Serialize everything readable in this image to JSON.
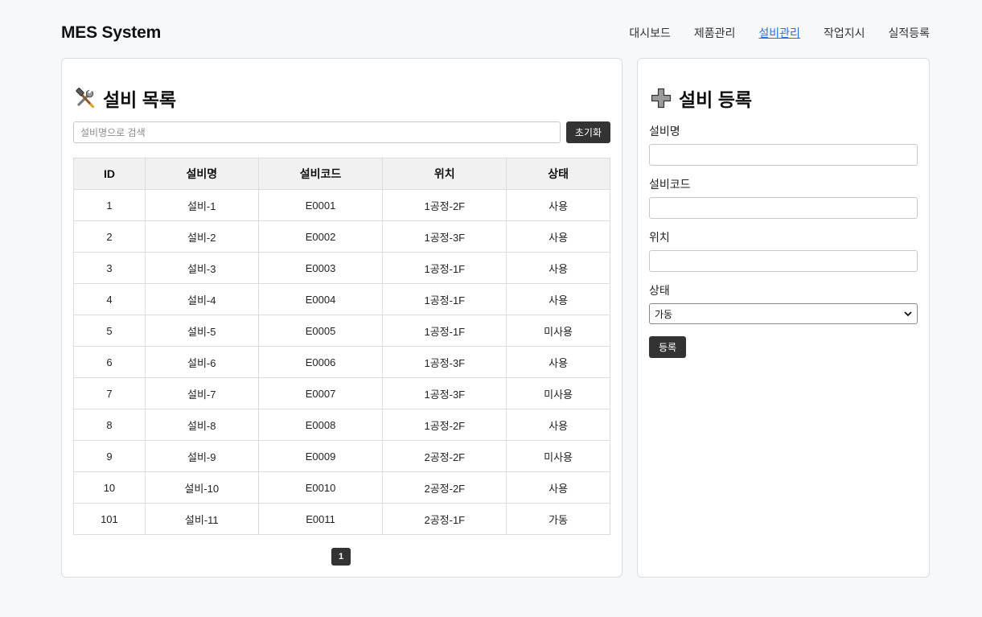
{
  "header": {
    "brand": "MES System",
    "nav": [
      {
        "label": "대시보드",
        "active": false
      },
      {
        "label": "제품관리",
        "active": false
      },
      {
        "label": "설비관리",
        "active": true
      },
      {
        "label": "작업지시",
        "active": false
      },
      {
        "label": "실적등록",
        "active": false
      }
    ]
  },
  "list": {
    "title": "설비 목록",
    "title_icon": "hammer-wrench-icon",
    "search_placeholder": "설비명으로 검색",
    "reset_label": "초기화",
    "columns": [
      "ID",
      "설비명",
      "설비코드",
      "위치",
      "상태"
    ],
    "rows": [
      [
        "1",
        "설비-1",
        "E0001",
        "1공정-2F",
        "사용"
      ],
      [
        "2",
        "설비-2",
        "E0002",
        "1공정-3F",
        "사용"
      ],
      [
        "3",
        "설비-3",
        "E0003",
        "1공정-1F",
        "사용"
      ],
      [
        "4",
        "설비-4",
        "E0004",
        "1공정-1F",
        "사용"
      ],
      [
        "5",
        "설비-5",
        "E0005",
        "1공정-1F",
        "미사용"
      ],
      [
        "6",
        "설비-6",
        "E0006",
        "1공정-3F",
        "사용"
      ],
      [
        "7",
        "설비-7",
        "E0007",
        "1공정-3F",
        "미사용"
      ],
      [
        "8",
        "설비-8",
        "E0008",
        "1공정-2F",
        "사용"
      ],
      [
        "9",
        "설비-9",
        "E0009",
        "2공정-2F",
        "미사용"
      ],
      [
        "10",
        "설비-10",
        "E0010",
        "2공정-2F",
        "사용"
      ],
      [
        "101",
        "설비-11",
        "E0011",
        "2공정-1F",
        "가동"
      ]
    ],
    "pages": [
      "1"
    ]
  },
  "form": {
    "title": "설비 등록",
    "title_icon": "plus-icon",
    "name_label": "설비명",
    "code_label": "설비코드",
    "location_label": "위치",
    "status_label": "상태",
    "status_value": "가동",
    "submit_label": "등록"
  },
  "colors": {
    "accent_link": "#2a6fd6",
    "dark_button": "#333333",
    "background": "#f7f8fa"
  }
}
